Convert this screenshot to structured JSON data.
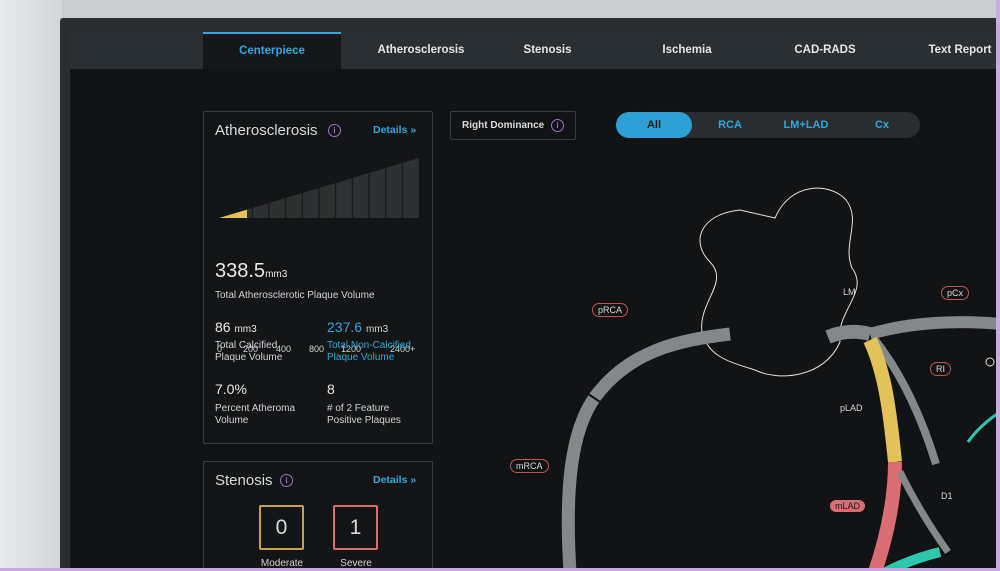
{
  "tabs": [
    {
      "label": "Centerpiece",
      "active": true
    },
    {
      "label": "Atherosclerosis",
      "active": false
    },
    {
      "label": "Stenosis",
      "active": false
    },
    {
      "label": "Ischemia",
      "active": false
    },
    {
      "label": "CAD-RADS",
      "active": false
    },
    {
      "label": "Text Report",
      "active": false
    }
  ],
  "atherosclerosis": {
    "title": "Atherosclerosis",
    "info_icon": "i",
    "details_label": "Details",
    "details_icon": "double-chevron-right-icon",
    "scale_ticks": [
      "0",
      "200",
      "400",
      "800",
      "1200",
      "2400+"
    ],
    "scale_fill_fraction": 0.14,
    "total_value": "338.5",
    "total_unit": "mm3",
    "total_label": "Total Atherosclerotic Plaque Volume",
    "calcified_value": "86",
    "calcified_unit": "mm3",
    "calcified_label_1": "Total Calcified",
    "calcified_label_2": "Plaque Volume",
    "noncalcified_value": "237.6",
    "noncalcified_unit": "mm3",
    "noncalcified_label_1": "Total Non-Calcified",
    "noncalcified_label_2": "Plaque Volume",
    "percent_value": "7.0%",
    "percent_label_1": "Percent Atheroma",
    "percent_label_2": "Volume",
    "feature_value": "8",
    "feature_label_1": "# of 2 Feature",
    "feature_label_2": "Positive Plaques"
  },
  "stenosis": {
    "title": "Stenosis",
    "info_icon": "i",
    "details_label": "Details",
    "moderate_value": "0",
    "moderate_label": "Moderate",
    "severe_value": "1",
    "severe_label": "Severe"
  },
  "dominance": {
    "label": "Right Dominance",
    "info_icon": "i"
  },
  "vessel_filter": {
    "options": [
      "All",
      "RCA",
      "LM+LAD",
      "Cx"
    ],
    "selected": "All"
  },
  "segments": {
    "pRCA": "pRCA",
    "mRCA": "mRCA",
    "LM": "LM",
    "pCx": "pCx",
    "RI": "RI",
    "pLAD": "pLAD",
    "mLAD": "mLAD",
    "D1": "D1"
  },
  "colors": {
    "accent": "#2fa7dc",
    "calcified": "#e2c35a",
    "noncalcified_stenosis": "#d86e74",
    "vessel": "#8a8d90",
    "moderate_border": "#c9a050",
    "severe_border": "#d86e74",
    "cx_branch": "#2fc6b0"
  }
}
